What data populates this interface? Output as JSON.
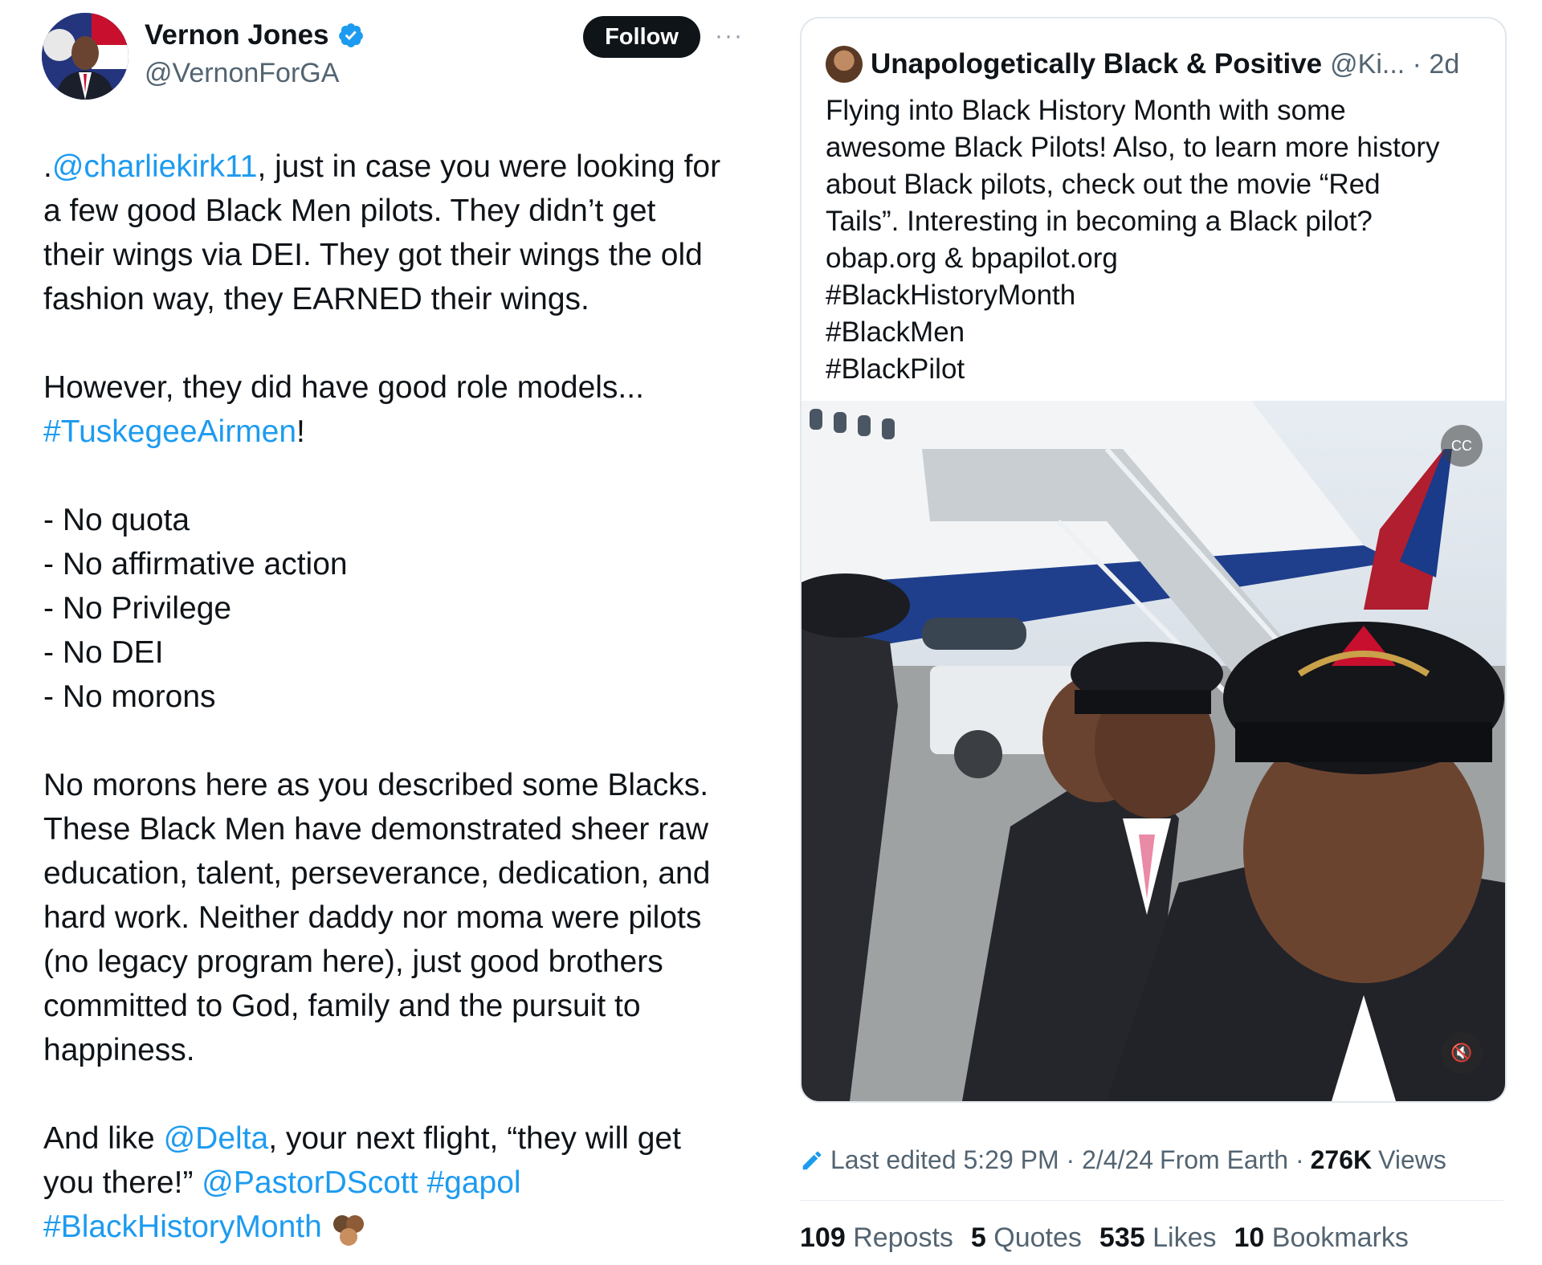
{
  "author": {
    "name": "Vernon Jones",
    "handle": "@VernonForGA",
    "follow_label": "Follow",
    "more_label": "···"
  },
  "tweet": {
    "lines": [
      {
        "parts": [
          {
            "t": "."
          },
          {
            "t": "@charliekirk11",
            "link": true
          },
          {
            "t": ", just in case you were looking for"
          }
        ]
      },
      {
        "parts": [
          {
            "t": "a few good Black Men pilots. They didn’t get"
          }
        ]
      },
      {
        "parts": [
          {
            "t": "their wings via DEI. They got their wings the old"
          }
        ]
      },
      {
        "parts": [
          {
            "t": "fashion way, they EARNED their wings."
          }
        ]
      },
      {
        "gap": true
      },
      {
        "parts": [
          {
            "t": "However, they did have good role models..."
          }
        ]
      },
      {
        "parts": [
          {
            "t": "#TuskegeeAirmen",
            "link": true
          },
          {
            "t": "!"
          }
        ]
      },
      {
        "gap": true
      },
      {
        "parts": [
          {
            "t": "- No quota"
          }
        ]
      },
      {
        "parts": [
          {
            "t": "- No affirmative action"
          }
        ]
      },
      {
        "parts": [
          {
            "t": "- No Privilege"
          }
        ]
      },
      {
        "parts": [
          {
            "t": "- No DEI"
          }
        ]
      },
      {
        "parts": [
          {
            "t": "- No morons"
          }
        ]
      },
      {
        "gap": true
      },
      {
        "parts": [
          {
            "t": "No morons here as you described some Blacks."
          }
        ]
      },
      {
        "parts": [
          {
            "t": "These Black Men have demonstrated sheer raw"
          }
        ]
      },
      {
        "parts": [
          {
            "t": "education, talent, perseverance, dedication, and"
          }
        ]
      },
      {
        "parts": [
          {
            "t": "hard work.  Neither daddy nor moma were pilots"
          }
        ]
      },
      {
        "parts": [
          {
            "t": "(no legacy program here), just good brothers"
          }
        ]
      },
      {
        "parts": [
          {
            "t": "committed to God, family and the pursuit to"
          }
        ]
      },
      {
        "parts": [
          {
            "t": "happiness."
          }
        ]
      },
      {
        "gap": true
      },
      {
        "parts": [
          {
            "t": "And like "
          },
          {
            "t": "@Delta",
            "link": true
          },
          {
            "t": ", your next flight, “they will get"
          }
        ]
      },
      {
        "parts": [
          {
            "t": "you there!”  "
          },
          {
            "t": "@PastorDScott",
            "link": true
          },
          {
            "t": " "
          },
          {
            "t": "#gapol",
            "link": true
          }
        ]
      },
      {
        "parts": [
          {
            "t": "#BlackHistoryMonth",
            "link": true
          }
        ],
        "emoji": "raised-fists-emoji"
      }
    ]
  },
  "quoted": {
    "name": "Unapologetically Black & Positive",
    "handle": "@Ki... · 2d",
    "lines": [
      "Flying into Black History Month with some",
      "awesome Black Pilots! Also, to learn more history",
      "about Black pilots, check out the movie “Red",
      "Tails”. Interesting in becoming a Black pilot?",
      "obap.org & bpapilot.org",
      "#BlackHistoryMonth",
      "#BlackMen",
      "#BlackPilot"
    ],
    "media": {
      "cc_icon": "captions-icon",
      "mute_icon": "muted-speaker-icon"
    }
  },
  "meta": {
    "edited": "Last edited 5:29 PM · 2/4/24",
    "location": "From Earth ·",
    "views_count": "276K",
    "views_label": "Views"
  },
  "stats": [
    {
      "count": "109",
      "label": "Reposts"
    },
    {
      "count": "5",
      "label": "Quotes"
    },
    {
      "count": "535",
      "label": "Likes"
    },
    {
      "count": "10",
      "label": "Bookmarks"
    }
  ],
  "colors": {
    "link": "#1d9bf0",
    "text": "#0f1419",
    "muted": "#536471",
    "verified": "#1d9bf0"
  }
}
